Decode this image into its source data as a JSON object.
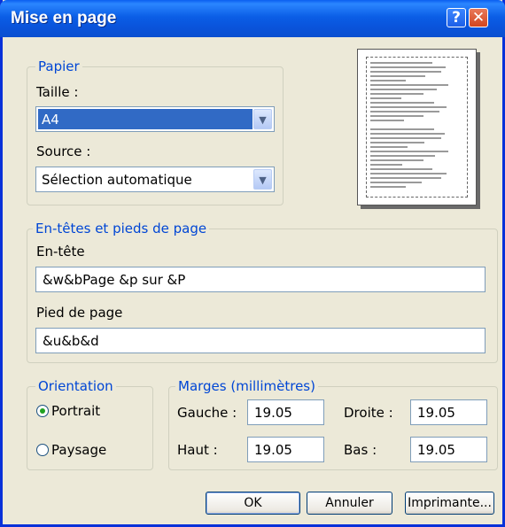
{
  "window": {
    "title": "Mise en page"
  },
  "titlebar": {
    "help_icon": "question-mark",
    "close_icon": "x-mark"
  },
  "paper": {
    "legend": "Papier",
    "size_label": "Taille :",
    "size_value": "A4",
    "source_label": "Source :",
    "source_value": "Sélection automatique"
  },
  "headers": {
    "legend": "En-têtes et pieds de page",
    "header_label": "En-tête",
    "header_value": "&w&bPage &p sur &P",
    "footer_label": "Pied de page",
    "footer_value": "&u&b&d"
  },
  "orientation": {
    "legend": "Orientation",
    "options": [
      {
        "label": "Portrait",
        "selected": true
      },
      {
        "label": "Paysage",
        "selected": false
      }
    ]
  },
  "margins": {
    "legend": "Marges (millimètres)",
    "left_label": "Gauche :",
    "left_value": "19.05",
    "right_label": "Droite :",
    "right_value": "19.05",
    "top_label": "Haut :",
    "top_value": "19.05",
    "bottom_label": "Bas :",
    "bottom_value": "19.05"
  },
  "buttons": {
    "ok": "OK",
    "cancel": "Annuler",
    "printer": "Imprimante..."
  },
  "colors": {
    "titlebar": "#0a5ee6",
    "window_border": "#0831d9",
    "legend_text": "#0046d5",
    "dialog_bg": "#ece9d8",
    "selection": "#316ac5"
  }
}
